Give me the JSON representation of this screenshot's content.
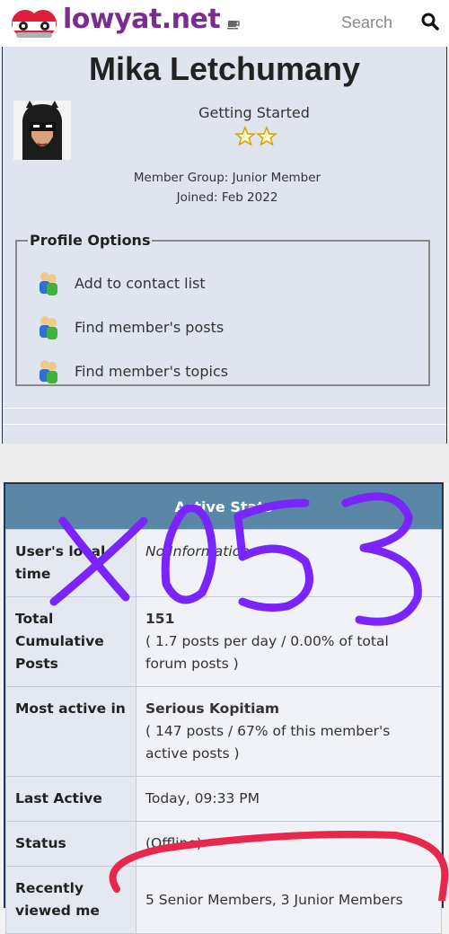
{
  "header": {
    "site_name": "lowyat.net",
    "search_placeholder": "Search"
  },
  "profile": {
    "name": "Mika Letchumany",
    "rank_title": "Getting Started",
    "member_group": "Member Group: Junior Member",
    "joined": "Joined: Feb 2022",
    "stars": 2,
    "options_title": "Profile Options",
    "options": [
      {
        "label": "Add to contact list"
      },
      {
        "label": "Find member's posts"
      },
      {
        "label": "Find member's topics"
      }
    ]
  },
  "stats": {
    "header": "Active Stats",
    "rows": {
      "local_time": {
        "key": "User's local time",
        "value": "No Information"
      },
      "posts": {
        "key": "Total Cumulative Posts",
        "value": "151",
        "detail": "( 1.7 posts per day / 0.00% of total forum posts )"
      },
      "most_active": {
        "key": "Most active in",
        "value": "Serious Kopitiam",
        "detail": "( 147 posts / 67% of this member's active posts )"
      },
      "last_active": {
        "key": "Last Active",
        "value": "Today, 09:33 PM"
      },
      "status": {
        "key": "Status",
        "value": "(Offline)"
      },
      "recently_viewed": {
        "key": "Recently viewed me",
        "value": "5 Senior Members, 3 Junior Members"
      }
    }
  },
  "annotations": {
    "handwritten_text": "X053"
  },
  "colors": {
    "accent": "#7a2c91",
    "stats_header": "#5a87a5",
    "card_bg": "#dfe4ef",
    "scribble_purple": "#7a25ff",
    "scribble_red": "#e8274b"
  }
}
